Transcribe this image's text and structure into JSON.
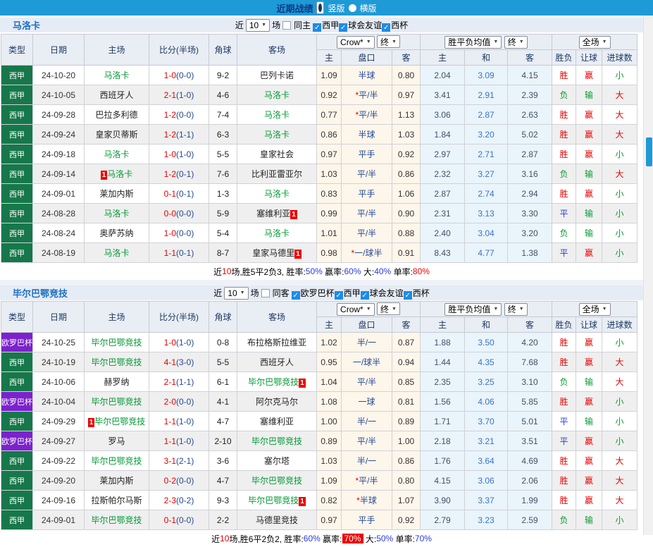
{
  "topbar": {
    "title": "近期战绩",
    "radio_vertical": "竖版",
    "radio_horizontal": "横版"
  },
  "colors": {
    "topbar_blue": "#1e9ad6",
    "title_navy": "#0a3a85",
    "league_colors": {
      "西甲": "#16784a",
      "欧罗巴杯": "#7c22cc"
    },
    "focus_team_green": "#009933",
    "score_red": "#e80000",
    "half_navy": "#254a9a",
    "avg_draw_blue": "#3a74c9",
    "win_red": "#e80000",
    "lose_green": "#089b30",
    "draw_blue": "#2b3cd8"
  },
  "table_headers": {
    "type": "类型",
    "date": "日期",
    "home": "主场",
    "score": "比分(半场)",
    "corners": "角球",
    "away": "客场",
    "odds_home": "主",
    "handicap": "盘口",
    "odds_away": "客",
    "avg_home": "主",
    "avg_draw": "和",
    "avg_away": "客",
    "result": "胜负",
    "handicap_result": "让球",
    "goals": "进球数"
  },
  "selects": {
    "odds_source": "Crow*",
    "final_a": "终",
    "avg": "胜平负均值",
    "final_b": "终",
    "scope": "全场"
  },
  "result_class_map": {
    "胜": "r-red",
    "赢": "r-red",
    "大": "r-red",
    "平": "r-blue",
    "负": "r-green",
    "输": "r-green",
    "小": "r-green"
  },
  "sections": [
    {
      "team": "马洛卡",
      "filters": {
        "near": "近",
        "count": "10",
        "unit": "场",
        "same_label": "同主",
        "same_checked": false,
        "leagues": [
          {
            "label": "西甲",
            "checked": true
          },
          {
            "label": "球会友谊",
            "checked": true
          },
          {
            "label": "西杯",
            "checked": true
          }
        ]
      },
      "rows": [
        {
          "league": "西甲",
          "date": "24-10-20",
          "home": "马洛卡",
          "home_focus": true,
          "home_card": false,
          "score": "1-0",
          "half": "(0-0)",
          "corners": "9-2",
          "away": "巴列卡诺",
          "away_focus": false,
          "away_card": false,
          "odds_home": "1.09",
          "handicap": "半球",
          "handicap_star": false,
          "odds_away": "0.80",
          "avg_home": "2.04",
          "avg_draw": "3.09",
          "avg_away": "4.15",
          "result": "胜",
          "handicap_result": "赢",
          "goals": "小"
        },
        {
          "league": "西甲",
          "date": "24-10-05",
          "home": "西班牙人",
          "home_focus": false,
          "home_card": false,
          "score": "2-1",
          "half": "(1-0)",
          "corners": "4-6",
          "away": "马洛卡",
          "away_focus": true,
          "away_card": false,
          "odds_home": "0.92",
          "handicap": "平/半",
          "handicap_star": true,
          "odds_away": "0.97",
          "avg_home": "3.41",
          "avg_draw": "2.91",
          "avg_away": "2.39",
          "result": "负",
          "handicap_result": "输",
          "goals": "大"
        },
        {
          "league": "西甲",
          "date": "24-09-28",
          "home": "巴拉多利德",
          "home_focus": false,
          "home_card": false,
          "score": "1-2",
          "half": "(0-0)",
          "corners": "7-4",
          "away": "马洛卡",
          "away_focus": true,
          "away_card": false,
          "odds_home": "0.77",
          "handicap": "平/半",
          "handicap_star": true,
          "odds_away": "1.13",
          "avg_home": "3.06",
          "avg_draw": "2.87",
          "avg_away": "2.63",
          "result": "胜",
          "handicap_result": "赢",
          "goals": "大"
        },
        {
          "league": "西甲",
          "date": "24-09-24",
          "home": "皇家贝蒂斯",
          "home_focus": false,
          "home_card": false,
          "score": "1-2",
          "half": "(1-1)",
          "corners": "6-3",
          "away": "马洛卡",
          "away_focus": true,
          "away_card": false,
          "odds_home": "0.86",
          "handicap": "半球",
          "handicap_star": false,
          "odds_away": "1.03",
          "avg_home": "1.84",
          "avg_draw": "3.20",
          "avg_away": "5.02",
          "result": "胜",
          "handicap_result": "赢",
          "goals": "大"
        },
        {
          "league": "西甲",
          "date": "24-09-18",
          "home": "马洛卡",
          "home_focus": true,
          "home_card": false,
          "score": "1-0",
          "half": "(1-0)",
          "corners": "5-5",
          "away": "皇家社会",
          "away_focus": false,
          "away_card": false,
          "odds_home": "0.97",
          "handicap": "平手",
          "handicap_star": false,
          "odds_away": "0.92",
          "avg_home": "2.97",
          "avg_draw": "2.71",
          "avg_away": "2.87",
          "result": "胜",
          "handicap_result": "赢",
          "goals": "小"
        },
        {
          "league": "西甲",
          "date": "24-09-14",
          "home": "马洛卡",
          "home_focus": true,
          "home_card": true,
          "score": "1-2",
          "half": "(0-1)",
          "corners": "7-6",
          "away": "比利亚雷亚尔",
          "away_focus": false,
          "away_card": false,
          "odds_home": "1.03",
          "handicap": "平/半",
          "handicap_star": false,
          "odds_away": "0.86",
          "avg_home": "2.32",
          "avg_draw": "3.27",
          "avg_away": "3.16",
          "result": "负",
          "handicap_result": "输",
          "goals": "大"
        },
        {
          "league": "西甲",
          "date": "24-09-01",
          "home": "莱加内斯",
          "home_focus": false,
          "home_card": false,
          "score": "0-1",
          "half": "(0-1)",
          "corners": "1-3",
          "away": "马洛卡",
          "away_focus": true,
          "away_card": false,
          "odds_home": "0.83",
          "handicap": "平手",
          "handicap_star": false,
          "odds_away": "1.06",
          "avg_home": "2.87",
          "avg_draw": "2.74",
          "avg_away": "2.94",
          "result": "胜",
          "handicap_result": "赢",
          "goals": "小"
        },
        {
          "league": "西甲",
          "date": "24-08-28",
          "home": "马洛卡",
          "home_focus": true,
          "home_card": false,
          "score": "0-0",
          "half": "(0-0)",
          "corners": "5-9",
          "away": "塞维利亚",
          "away_focus": false,
          "away_card": true,
          "odds_home": "0.99",
          "handicap": "平/半",
          "handicap_star": false,
          "odds_away": "0.90",
          "avg_home": "2.31",
          "avg_draw": "3.13",
          "avg_away": "3.30",
          "result": "平",
          "handicap_result": "输",
          "goals": "小"
        },
        {
          "league": "西甲",
          "date": "24-08-24",
          "home": "奥萨苏纳",
          "home_focus": false,
          "home_card": false,
          "score": "1-0",
          "half": "(0-0)",
          "corners": "5-4",
          "away": "马洛卡",
          "away_focus": true,
          "away_card": false,
          "odds_home": "1.01",
          "handicap": "平/半",
          "handicap_star": false,
          "odds_away": "0.88",
          "avg_home": "2.40",
          "avg_draw": "3.04",
          "avg_away": "3.20",
          "result": "负",
          "handicap_result": "输",
          "goals": "小"
        },
        {
          "league": "西甲",
          "date": "24-08-19",
          "home": "马洛卡",
          "home_focus": true,
          "home_card": false,
          "score": "1-1",
          "half": "(0-1)",
          "corners": "8-7",
          "away": "皇家马德里",
          "away_focus": false,
          "away_card": true,
          "odds_home": "0.98",
          "handicap": "一/球半",
          "handicap_star": true,
          "odds_away": "0.91",
          "avg_home": "8.43",
          "avg_draw": "4.77",
          "avg_away": "1.38",
          "result": "平",
          "handicap_result": "赢",
          "goals": "小"
        }
      ],
      "summary": [
        {
          "t": "近",
          "c": "k"
        },
        {
          "t": "10",
          "c": "r"
        },
        {
          "t": "场,胜5平2负3, 胜率:",
          "c": "k"
        },
        {
          "t": "50%",
          "c": "b"
        },
        {
          "t": " 赢率:",
          "c": "k"
        },
        {
          "t": "60%",
          "c": "b"
        },
        {
          "t": " 大:",
          "c": "k"
        },
        {
          "t": "40%",
          "c": "b"
        },
        {
          "t": " 单率:",
          "c": "k"
        },
        {
          "t": "80%",
          "c": "r"
        }
      ]
    },
    {
      "team": "毕尔巴鄂竞技",
      "filters": {
        "near": "近",
        "count": "10",
        "unit": "场",
        "same_label": "同客",
        "same_checked": false,
        "leagues": [
          {
            "label": "欧罗巴杯",
            "checked": true
          },
          {
            "label": "西甲",
            "checked": true
          },
          {
            "label": "球会友谊",
            "checked": true
          },
          {
            "label": "西杯",
            "checked": true
          }
        ]
      },
      "rows": [
        {
          "league": "欧罗巴杯",
          "date": "24-10-25",
          "home": "毕尔巴鄂竞技",
          "home_focus": true,
          "home_card": false,
          "score": "1-0",
          "half": "(1-0)",
          "corners": "0-8",
          "away": "布拉格斯拉维亚",
          "away_focus": false,
          "away_card": false,
          "odds_home": "1.02",
          "handicap": "半/一",
          "handicap_star": false,
          "odds_away": "0.87",
          "avg_home": "1.88",
          "avg_draw": "3.50",
          "avg_away": "4.20",
          "result": "胜",
          "handicap_result": "赢",
          "goals": "小"
        },
        {
          "league": "西甲",
          "date": "24-10-19",
          "home": "毕尔巴鄂竞技",
          "home_focus": true,
          "home_card": false,
          "score": "4-1",
          "half": "(3-0)",
          "corners": "5-5",
          "away": "西班牙人",
          "away_focus": false,
          "away_card": false,
          "odds_home": "0.95",
          "handicap": "一/球半",
          "handicap_star": false,
          "odds_away": "0.94",
          "avg_home": "1.44",
          "avg_draw": "4.35",
          "avg_away": "7.68",
          "result": "胜",
          "handicap_result": "赢",
          "goals": "大"
        },
        {
          "league": "西甲",
          "date": "24-10-06",
          "home": "赫罗纳",
          "home_focus": false,
          "home_card": false,
          "score": "2-1",
          "half": "(1-1)",
          "corners": "6-1",
          "away": "毕尔巴鄂竞技",
          "away_focus": true,
          "away_card": true,
          "odds_home": "1.04",
          "handicap": "平/半",
          "handicap_star": false,
          "odds_away": "0.85",
          "avg_home": "2.35",
          "avg_draw": "3.25",
          "avg_away": "3.10",
          "result": "负",
          "handicap_result": "输",
          "goals": "大"
        },
        {
          "league": "欧罗巴杯",
          "date": "24-10-04",
          "home": "毕尔巴鄂竞技",
          "home_focus": true,
          "home_card": false,
          "score": "2-0",
          "half": "(0-0)",
          "corners": "4-1",
          "away": "阿尔克马尔",
          "away_focus": false,
          "away_card": false,
          "odds_home": "1.08",
          "handicap": "一球",
          "handicap_star": false,
          "odds_away": "0.81",
          "avg_home": "1.56",
          "avg_draw": "4.06",
          "avg_away": "5.85",
          "result": "胜",
          "handicap_result": "赢",
          "goals": "小"
        },
        {
          "league": "西甲",
          "date": "24-09-29",
          "home": "毕尔巴鄂竞技",
          "home_focus": true,
          "home_card": true,
          "score": "1-1",
          "half": "(1-0)",
          "corners": "4-7",
          "away": "塞维利亚",
          "away_focus": false,
          "away_card": false,
          "odds_home": "1.00",
          "handicap": "半/一",
          "handicap_star": false,
          "odds_away": "0.89",
          "avg_home": "1.71",
          "avg_draw": "3.70",
          "avg_away": "5.01",
          "result": "平",
          "handicap_result": "输",
          "goals": "小"
        },
        {
          "league": "欧罗巴杯",
          "date": "24-09-27",
          "home": "罗马",
          "home_focus": false,
          "home_card": false,
          "score": "1-1",
          "half": "(1-0)",
          "corners": "2-10",
          "away": "毕尔巴鄂竞技",
          "away_focus": true,
          "away_card": false,
          "odds_home": "0.89",
          "handicap": "平/半",
          "handicap_star": false,
          "odds_away": "1.00",
          "avg_home": "2.18",
          "avg_draw": "3.21",
          "avg_away": "3.51",
          "result": "平",
          "handicap_result": "赢",
          "goals": "小"
        },
        {
          "league": "西甲",
          "date": "24-09-22",
          "home": "毕尔巴鄂竞技",
          "home_focus": true,
          "home_card": false,
          "score": "3-1",
          "half": "(2-1)",
          "corners": "3-6",
          "away": "塞尔塔",
          "away_focus": false,
          "away_card": false,
          "odds_home": "1.03",
          "handicap": "半/一",
          "handicap_star": false,
          "odds_away": "0.86",
          "avg_home": "1.76",
          "avg_draw": "3.64",
          "avg_away": "4.69",
          "result": "胜",
          "handicap_result": "赢",
          "goals": "大"
        },
        {
          "league": "西甲",
          "date": "24-09-20",
          "home": "莱加内斯",
          "home_focus": false,
          "home_card": false,
          "score": "0-2",
          "half": "(0-0)",
          "corners": "4-7",
          "away": "毕尔巴鄂竞技",
          "away_focus": true,
          "away_card": false,
          "odds_home": "1.09",
          "handicap": "平/半",
          "handicap_star": true,
          "odds_away": "0.80",
          "avg_home": "4.15",
          "avg_draw": "3.06",
          "avg_away": "2.06",
          "result": "胜",
          "handicap_result": "赢",
          "goals": "大"
        },
        {
          "league": "西甲",
          "date": "24-09-16",
          "home": "拉斯帕尔马斯",
          "home_focus": false,
          "home_card": false,
          "score": "2-3",
          "half": "(0-2)",
          "corners": "9-3",
          "away": "毕尔巴鄂竞技",
          "away_focus": true,
          "away_card": true,
          "odds_home": "0.82",
          "handicap": "半球",
          "handicap_star": true,
          "odds_away": "1.07",
          "avg_home": "3.90",
          "avg_draw": "3.37",
          "avg_away": "1.99",
          "result": "胜",
          "handicap_result": "赢",
          "goals": "大"
        },
        {
          "league": "西甲",
          "date": "24-09-01",
          "home": "毕尔巴鄂竞技",
          "home_focus": true,
          "home_card": false,
          "score": "0-1",
          "half": "(0-0)",
          "corners": "2-2",
          "away": "马德里竞技",
          "away_focus": false,
          "away_card": false,
          "odds_home": "0.97",
          "handicap": "平手",
          "handicap_star": false,
          "odds_away": "0.92",
          "avg_home": "2.79",
          "avg_draw": "3.23",
          "avg_away": "2.59",
          "result": "负",
          "handicap_result": "输",
          "goals": "小"
        }
      ],
      "summary": [
        {
          "t": "近",
          "c": "k"
        },
        {
          "t": "10",
          "c": "r"
        },
        {
          "t": "场,胜6平2负2, 胜率:",
          "c": "k"
        },
        {
          "t": "60%",
          "c": "b"
        },
        {
          "t": " 赢率:",
          "c": "k"
        },
        {
          "t": "70%",
          "c": "rb"
        },
        {
          "t": " 大:",
          "c": "k"
        },
        {
          "t": "50%",
          "c": "b"
        },
        {
          "t": " 单率:",
          "c": "k"
        },
        {
          "t": "70%",
          "c": "b"
        }
      ]
    }
  ]
}
